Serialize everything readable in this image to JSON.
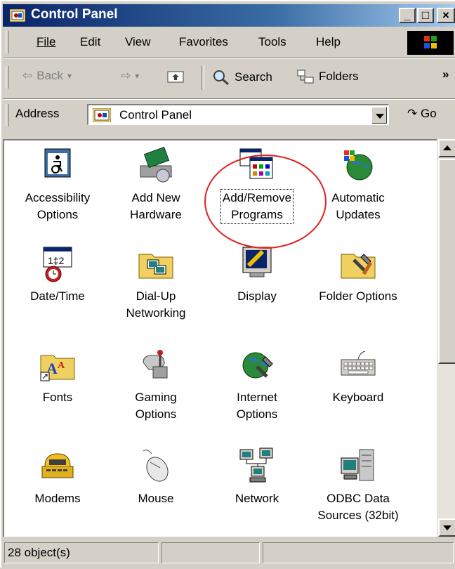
{
  "window": {
    "title": "Control Panel"
  },
  "title_buttons": {
    "minimize": "_",
    "maximize": "□",
    "close": "×"
  },
  "menu": [
    "File",
    "Edit",
    "View",
    "Favorites",
    "Tools",
    "Help"
  ],
  "toolbar": {
    "back": "Back",
    "search": "Search",
    "folders": "Folders",
    "more": "»"
  },
  "address": {
    "label": "Address",
    "value": "Control Panel",
    "go": "Go"
  },
  "items": [
    {
      "label": [
        "Accessibility",
        "Options"
      ],
      "icon": "accessibility-icon"
    },
    {
      "label": [
        "Add New",
        "Hardware"
      ],
      "icon": "add-hardware-icon"
    },
    {
      "label": [
        "Add/Remove",
        "Programs"
      ],
      "icon": "add-remove-programs-icon"
    },
    {
      "label": [
        "Automatic",
        "Updates"
      ],
      "icon": "automatic-updates-icon"
    },
    {
      "label": [
        "Date/Time",
        ""
      ],
      "icon": "date-time-icon"
    },
    {
      "label": [
        "Dial-Up",
        "Networking"
      ],
      "icon": "dial-up-networking-icon"
    },
    {
      "label": [
        "Display",
        ""
      ],
      "icon": "display-icon"
    },
    {
      "label": [
        "Folder Options",
        ""
      ],
      "icon": "folder-options-icon"
    },
    {
      "label": [
        "Fonts",
        ""
      ],
      "icon": "fonts-icon"
    },
    {
      "label": [
        "Gaming",
        "Options"
      ],
      "icon": "gaming-options-icon"
    },
    {
      "label": [
        "Internet",
        "Options"
      ],
      "icon": "internet-options-icon"
    },
    {
      "label": [
        "Keyboard",
        ""
      ],
      "icon": "keyboard-icon"
    },
    {
      "label": [
        "Modems",
        ""
      ],
      "icon": "modems-icon"
    },
    {
      "label": [
        "Mouse",
        ""
      ],
      "icon": "mouse-icon"
    },
    {
      "label": [
        "Network",
        ""
      ],
      "icon": "network-icon"
    },
    {
      "label": [
        "ODBC Data",
        "Sources (32bit)"
      ],
      "icon": "odbc-data-sources-icon"
    }
  ],
  "status": {
    "count": "28 object(s)"
  }
}
